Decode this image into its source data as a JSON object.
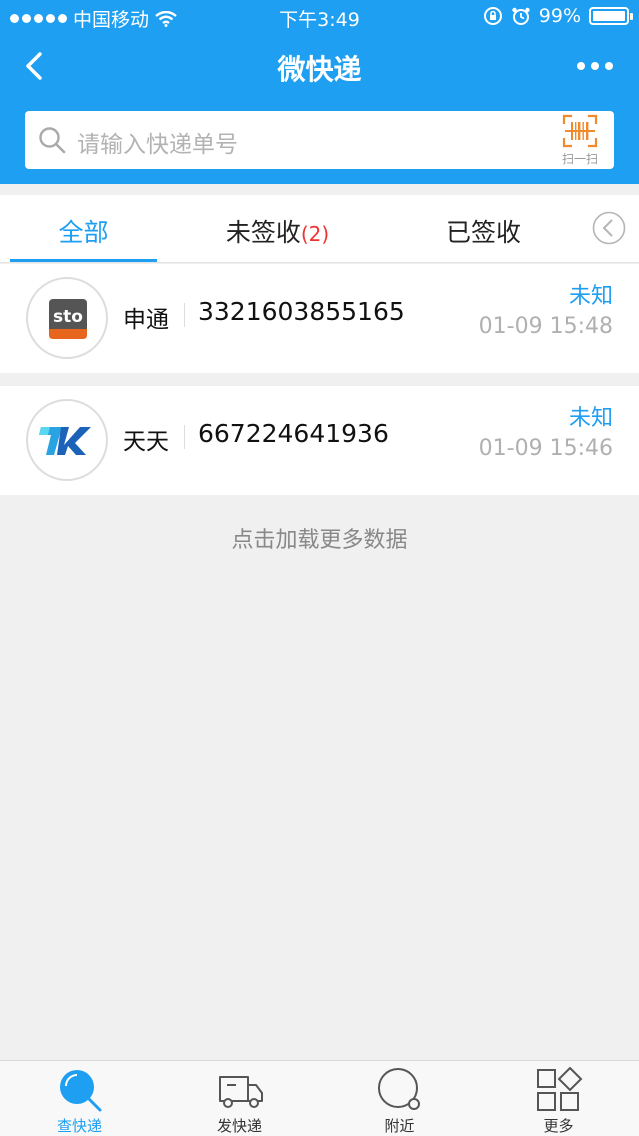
{
  "status_bar": {
    "carrier": "中国移动",
    "time": "下午3:49",
    "battery": "99%"
  },
  "nav": {
    "title": "微快递"
  },
  "search": {
    "placeholder": "请输入快递单号",
    "scan_label": "扫一扫"
  },
  "tabs": [
    {
      "label": "全部"
    },
    {
      "label": "未签收",
      "badge": "(2)"
    },
    {
      "label": "已签收"
    }
  ],
  "items": [
    {
      "company": "申通",
      "tracking": "3321603855165",
      "status": "未知",
      "time": "01-09 15:48",
      "logo": "sto-logo"
    },
    {
      "company": "天天",
      "tracking": "667224641936",
      "status": "未知",
      "time": "01-09 15:46",
      "logo": "tiantian-logo"
    }
  ],
  "load_more": "点击加载更多数据",
  "bottom_tabs": [
    {
      "label": "查快递",
      "icon": "search-icon"
    },
    {
      "label": "发快递",
      "icon": "truck-icon"
    },
    {
      "label": "附近",
      "icon": "nearby-icon"
    },
    {
      "label": "更多",
      "icon": "grid-icon"
    }
  ],
  "colors": {
    "primary": "#1e9ff2",
    "badge": "#e33333",
    "background": "#f0f0f0"
  }
}
